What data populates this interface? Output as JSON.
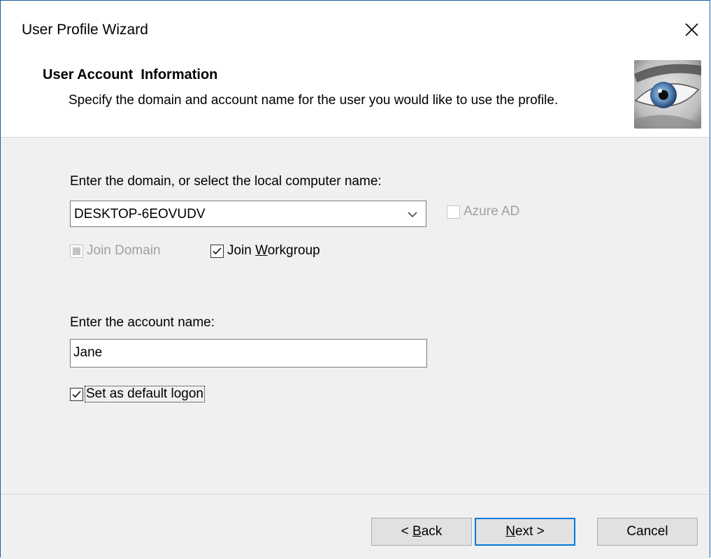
{
  "window": {
    "title": "User Profile Wizard"
  },
  "header": {
    "title": "User Account  Information",
    "subtitle": "Specify the domain and account name for the user you would like to use the profile."
  },
  "domain": {
    "label": "Enter the domain, or select the local computer name:",
    "selected": "DESKTOP-6EOVUDV",
    "azure_ad_label": "Azure AD",
    "azure_ad_checked": false,
    "azure_ad_enabled": false
  },
  "join": {
    "domain_label": "Join Domain",
    "domain_state": "indeterminate-disabled",
    "workgroup_label_pre": "Join ",
    "workgroup_label_accel": "W",
    "workgroup_label_post": "orkgroup",
    "workgroup_checked": true
  },
  "account": {
    "label": "Enter the account name:",
    "value": "Jane",
    "default_logon_label": "Set as default logon",
    "default_logon_checked": true
  },
  "buttons": {
    "back_pre": "< ",
    "back_accel": "B",
    "back_post": "ack",
    "next_accel": "N",
    "next_post": "ext >",
    "cancel": "Cancel"
  },
  "colors": {
    "accent": "#0078d7",
    "window_border": "#1f5f9e",
    "dialog_bg": "#f0f0f0"
  },
  "icons": {
    "close": "close-icon",
    "dropdown": "chevron-down-icon",
    "logo": "eye-logo"
  }
}
